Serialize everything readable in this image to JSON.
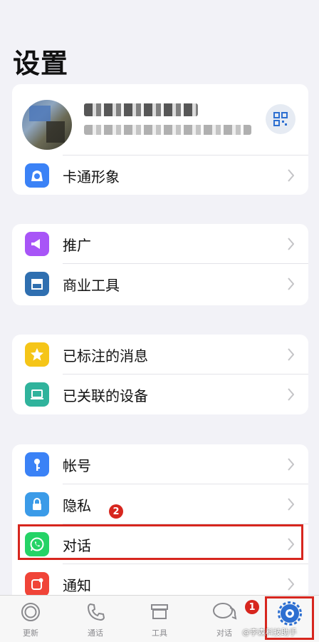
{
  "page": {
    "title": "设置"
  },
  "profile": {
    "avatar_icon": "avatar-image",
    "qr_icon": "qr-code-icon"
  },
  "groups": [
    {
      "items": [
        {
          "label": "卡通形象",
          "icon": "avatar-face-icon",
          "color": "#3b82f6"
        }
      ]
    },
    {
      "items": [
        {
          "label": "推广",
          "icon": "megaphone-icon",
          "color": "#a855f7"
        },
        {
          "label": "商业工具",
          "icon": "storefront-icon",
          "color": "#2f6fb0"
        }
      ]
    },
    {
      "items": [
        {
          "label": "已标注的消息",
          "icon": "star-icon",
          "color": "#f5c518"
        },
        {
          "label": "已关联的设备",
          "icon": "laptop-icon",
          "color": "#30b39c"
        }
      ]
    },
    {
      "items": [
        {
          "label": "帐号",
          "icon": "key-icon",
          "color": "#3b82f6"
        },
        {
          "label": "隐私",
          "icon": "lock-icon",
          "color": "#3b9be8"
        },
        {
          "label": "对话",
          "icon": "whatsapp-icon",
          "color": "#25d366"
        },
        {
          "label": "通知",
          "icon": "notification-icon",
          "color": "#f04438"
        }
      ]
    }
  ],
  "annotations": {
    "badge_1": "1",
    "badge_2": "2"
  },
  "tabbar": [
    {
      "label": "更新",
      "icon": "updates-icon"
    },
    {
      "label": "通话",
      "icon": "phone-icon"
    },
    {
      "label": "工具",
      "icon": "storefront-icon"
    },
    {
      "label": "对话",
      "icon": "chat-bubbles-icon"
    },
    {
      "label": "",
      "icon": "settings-gear-icon",
      "active": true
    }
  ],
  "watermark": "@李森科技助手"
}
